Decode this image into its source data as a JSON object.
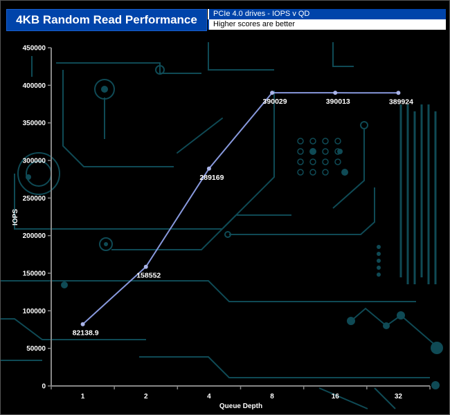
{
  "header": {
    "title": "4KB Random Read Performance",
    "subtitle": "PCIe 4.0 drives - IOPS v QD",
    "note": "Higher scores are better"
  },
  "colors": {
    "title_bg": "#0044aa",
    "series_line": "#8899dd",
    "background": "#000000",
    "circuit": "#0f4a55"
  },
  "chart_data": {
    "type": "line",
    "title": "4KB Random Read Performance",
    "subtitle": "PCIe 4.0 drives - IOPS v QD",
    "xlabel": "Queue Depth",
    "ylabel": "IOPS",
    "categories": [
      "1",
      "2",
      "4",
      "8",
      "16",
      "32"
    ],
    "values": [
      82138.9,
      158552,
      289169,
      390029,
      390013,
      389924
    ],
    "data_labels": [
      "82138.9",
      "158552",
      "289169",
      "390029",
      "390013",
      "389924"
    ],
    "ylim": [
      0,
      450000
    ],
    "yticks": [
      0,
      50000,
      100000,
      150000,
      200000,
      250000,
      300000,
      350000,
      400000,
      450000
    ],
    "grid": false,
    "legend": "none"
  }
}
